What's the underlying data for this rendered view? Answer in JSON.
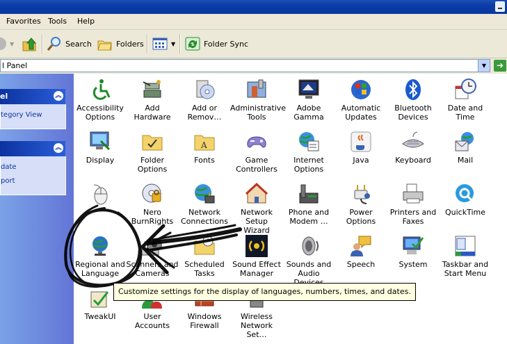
{
  "menu": {
    "items": [
      "Favorites",
      "Tools",
      "Help"
    ]
  },
  "toolbar": {
    "search": "Search",
    "folders": "Folders",
    "folder_sync": "Folder Sync"
  },
  "address": {
    "value": "l Panel"
  },
  "left_pane": {
    "panel1": {
      "title": "el",
      "link": "tegory View"
    },
    "panel2": {
      "links": [
        "date",
        "port"
      ]
    }
  },
  "items": [
    {
      "l1": "Accessibility",
      "l2": "Options",
      "icon": "accessibility-icon"
    },
    {
      "l1": "Add Hardware",
      "l2": "",
      "icon": "add-hardware-icon"
    },
    {
      "l1": "Add or",
      "l2": "Remov…",
      "icon": "add-remove-programs-icon"
    },
    {
      "l1": "Administrative",
      "l2": "Tools",
      "icon": "administrative-tools-icon"
    },
    {
      "l1": "Adobe Gamma",
      "l2": "",
      "icon": "adobe-gamma-icon"
    },
    {
      "l1": "Automatic",
      "l2": "Updates",
      "icon": "automatic-updates-icon"
    },
    {
      "l1": "Bluetooth",
      "l2": "Devices",
      "icon": "bluetooth-icon"
    },
    {
      "l1": "Date and Time",
      "l2": "",
      "icon": "date-time-icon"
    },
    {
      "l1": "Display",
      "l2": "",
      "icon": "display-icon"
    },
    {
      "l1": "Folder Options",
      "l2": "",
      "icon": "folder-options-icon"
    },
    {
      "l1": "Fonts",
      "l2": "",
      "icon": "fonts-icon"
    },
    {
      "l1": "Game",
      "l2": "Controllers",
      "icon": "game-controllers-icon"
    },
    {
      "l1": "Internet",
      "l2": "Options",
      "icon": "internet-options-icon"
    },
    {
      "l1": "Java",
      "l2": "",
      "icon": "java-icon"
    },
    {
      "l1": "Keyboard",
      "l2": "",
      "icon": "keyboard-icon"
    },
    {
      "l1": "Mail",
      "l2": "",
      "icon": "mail-icon"
    },
    {
      "l1": "",
      "l2": "",
      "icon": "mouse-icon"
    },
    {
      "l1": "Nero",
      "l2": "BurnRights",
      "icon": "nero-burnrights-icon"
    },
    {
      "l1": "Network",
      "l2": "Connections",
      "icon": "network-connections-icon"
    },
    {
      "l1": "Network Setup",
      "l2": "Wizard",
      "icon": "network-setup-wizard-icon"
    },
    {
      "l1": "Phone and",
      "l2": "Modem …",
      "icon": "phone-modem-icon"
    },
    {
      "l1": "Power Options",
      "l2": "",
      "icon": "power-options-icon"
    },
    {
      "l1": "Printers and",
      "l2": "Faxes",
      "icon": "printers-faxes-icon"
    },
    {
      "l1": "QuickTime",
      "l2": "",
      "icon": "quicktime-icon"
    },
    {
      "l1": "Regional and",
      "l2": "Language",
      "icon": "regional-language-icon"
    },
    {
      "l1": "Scanners and",
      "l2": "Cameras",
      "icon": "scanners-cameras-icon"
    },
    {
      "l1": "Scheduled",
      "l2": "Tasks",
      "icon": "scheduled-tasks-icon"
    },
    {
      "l1": "Sound Effect",
      "l2": "Manager",
      "icon": "sound-effect-manager-icon"
    },
    {
      "l1": "Sounds and",
      "l2": "Audio Devices",
      "icon": "sounds-audio-icon"
    },
    {
      "l1": "Speech",
      "l2": "",
      "icon": "speech-icon"
    },
    {
      "l1": "System",
      "l2": "",
      "icon": "system-icon"
    },
    {
      "l1": "Taskbar and",
      "l2": "Start Menu",
      "icon": "taskbar-start-menu-icon"
    },
    {
      "l1": "TweakUI",
      "l2": "",
      "icon": "tweakui-icon"
    },
    {
      "l1": "User Accounts",
      "l2": "",
      "icon": "user-accounts-icon"
    },
    {
      "l1": "Windows",
      "l2": "Firewall",
      "icon": "windows-firewall-icon"
    },
    {
      "l1": "Wireless",
      "l2": "Network Set…",
      "icon": "wireless-network-icon"
    }
  ],
  "tooltip": {
    "text": "Customize settings for the display of languages, numbers, times, and dates."
  },
  "colors": {
    "title_blue": "#0a3aa8",
    "pane_blue": "#6375d6",
    "link_blue": "#0c32a0",
    "tooltip_bg": "#ffffe1"
  }
}
